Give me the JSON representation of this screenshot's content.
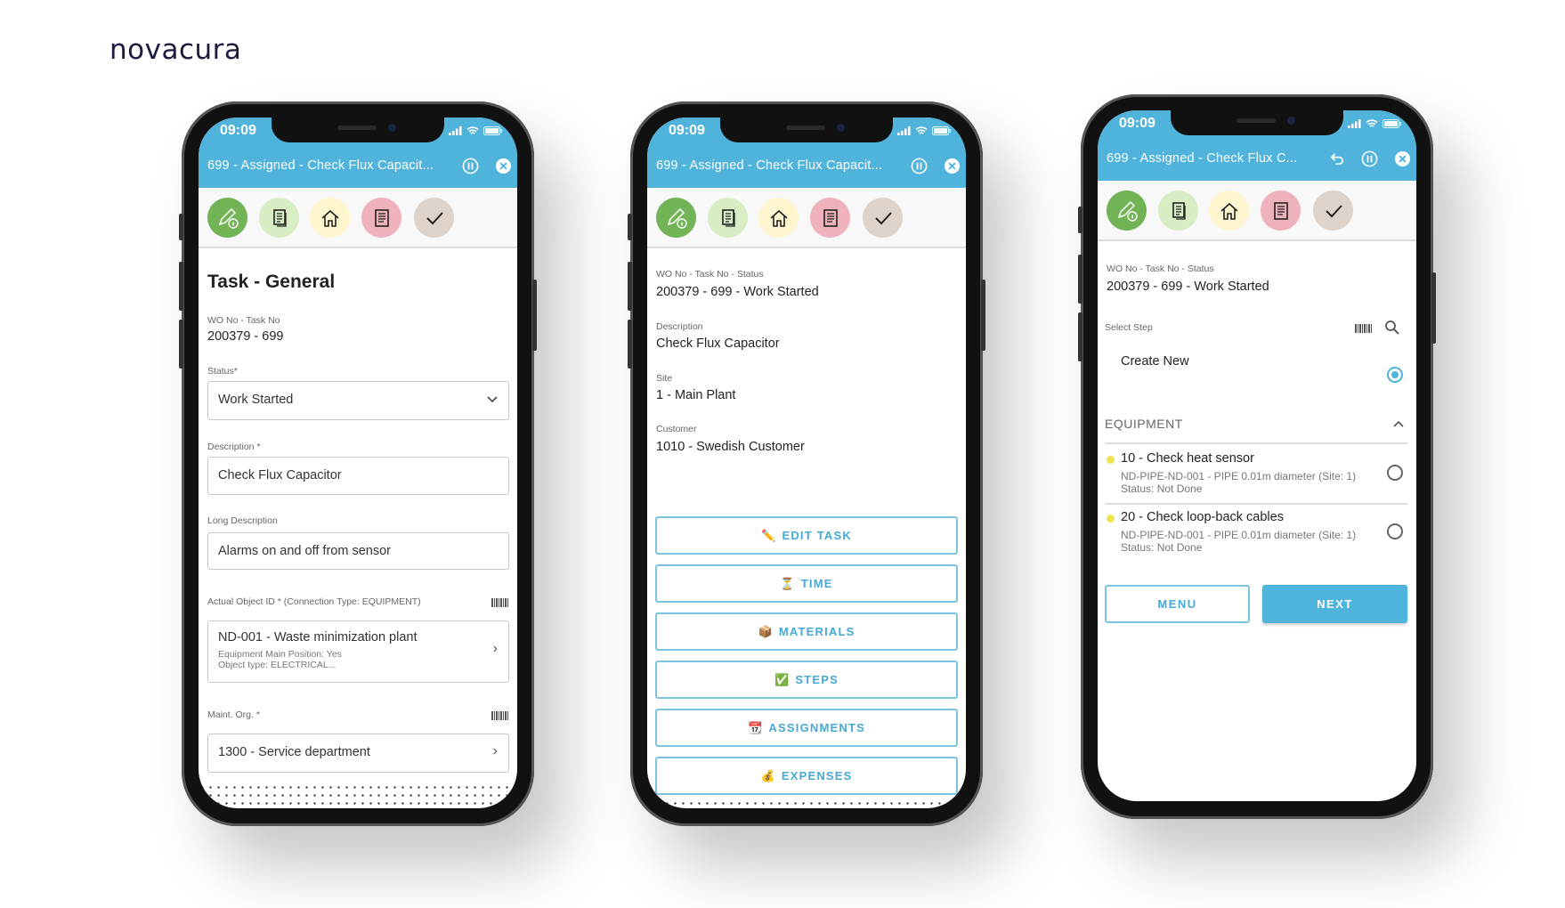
{
  "brand": {
    "logo": "novacura"
  },
  "colors": {
    "accent": "#4fb3dc",
    "icon_green": "#72b356",
    "icon_lightgreen": "#d8edc4",
    "icon_yellow": "#fdf6cf",
    "icon_pink": "#efb1bb",
    "icon_taupe": "#ddd3ca",
    "step_dot": "#efe44e"
  },
  "phones": [
    {
      "status_time": "09:09",
      "header": {
        "title": "699 - Assigned - Check Flux Capacit..."
      },
      "page_title": "Task - General",
      "fields": {
        "wo_label": "WO No - Task No",
        "wo_value": "200379 - 699",
        "status_label": "Status*",
        "status_value": "Work Started",
        "desc_label": "Description *",
        "desc_value": "Check Flux Capacitor",
        "longdesc_label": "Long Description",
        "longdesc_value": "Alarms on and off from sensor",
        "object_label": "Actual Object ID * (Connection Type: EQUIPMENT)",
        "object_value": "ND-001 - Waste minimization plant",
        "object_sub1": "Equipment Main Position: Yes",
        "object_sub2": "Object type: ELECTRICAL...",
        "org_label": "Maint. Org. *",
        "org_value": "1300 - Service department"
      }
    },
    {
      "status_time": "09:09",
      "header": {
        "title": "699 - Assigned - Check Flux Capacit..."
      },
      "fields": {
        "wo_label": "WO No - Task No - Status",
        "wo_value": "200379 - 699 - Work Started",
        "desc_label": "Description",
        "desc_value": "Check Flux Capacitor",
        "site_label": "Site",
        "site_value": "1 - Main Plant",
        "customer_label": "Customer",
        "customer_value": "1010 - Swedish Customer"
      },
      "actions": [
        {
          "icon": "✏️",
          "label": "EDIT TASK"
        },
        {
          "icon": "⏳",
          "label": "TIME"
        },
        {
          "icon": "📦",
          "label": "MATERIALS"
        },
        {
          "icon": "✅",
          "label": "STEPS"
        },
        {
          "icon": "📆",
          "label": "ASSIGNMENTS"
        },
        {
          "icon": "💰",
          "label": "EXPENSES"
        }
      ]
    },
    {
      "status_time": "09:09",
      "header": {
        "title": "699 - Assigned - Check Flux C..."
      },
      "fields": {
        "wo_label": "WO No - Task No - Status",
        "wo_value": "200379 - 699 - Work Started"
      },
      "select_step_label": "Select Step",
      "create_new": "Create New",
      "create_new_selected": true,
      "section": "EQUIPMENT",
      "steps": [
        {
          "title": "10 - Check heat sensor",
          "object": "ND-PIPE-ND-001 - PIPE 0.01m diameter (Site: 1)",
          "status": "Status: Not Done",
          "selected": false
        },
        {
          "title": "20 - Check loop-back cables",
          "object": "ND-PIPE-ND-001 - PIPE 0.01m diameter (Site: 1)",
          "status": "Status: Not Done",
          "selected": false
        }
      ],
      "menu_label": "MENU",
      "next_label": "NEXT"
    }
  ]
}
